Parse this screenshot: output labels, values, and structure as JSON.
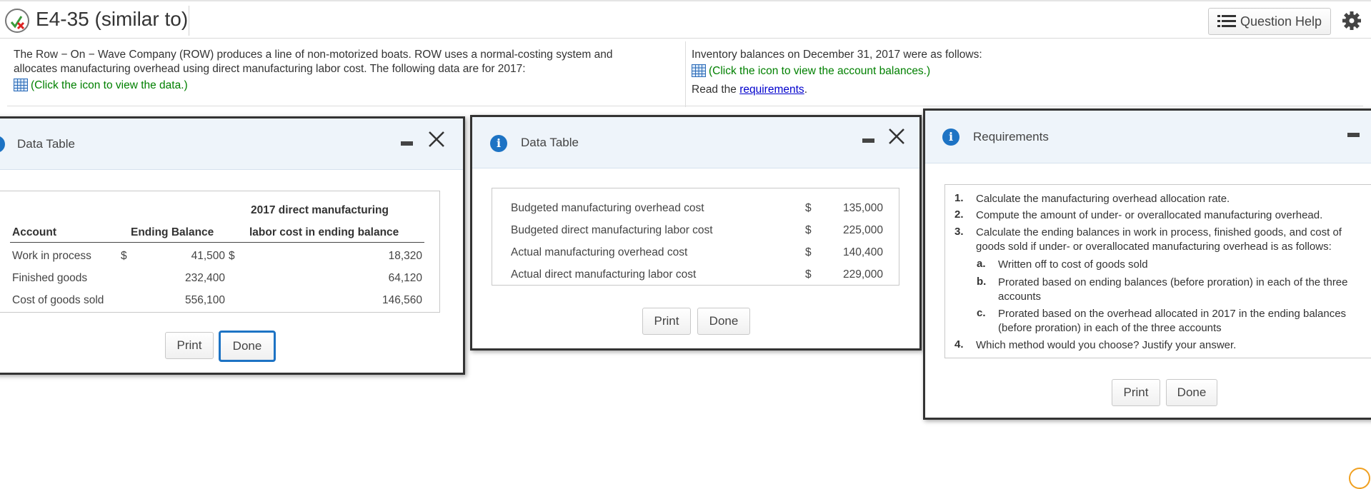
{
  "header": {
    "title": "E4-35 (similar to)",
    "question_help": "Question Help"
  },
  "problem": {
    "intro": "The Row − On − Wave Company (ROW) produces a line of non-motorized boats. ROW uses a normal-costing system and allocates manufacturing overhead using direct manufacturing labor cost. The following data are for 2017:",
    "data_link": "(Click the icon to view the data.)",
    "inventory_intro": "Inventory balances on December 31, 2017 were as follows:",
    "balances_link": "(Click the icon to view the account balances.)",
    "read_the": "Read the ",
    "requirements_link": "requirements",
    "period": "."
  },
  "dialog1": {
    "title": "Data Table",
    "header_line1": "2017 direct manufacturing",
    "col_account": "Account",
    "col_ending": "Ending Balance",
    "col_labor": "labor cost in ending balance",
    "rows": [
      {
        "account": "Work in process",
        "cur1": "$",
        "ending": "41,500",
        "cur2": "$",
        "labor": "18,320"
      },
      {
        "account": "Finished goods",
        "cur1": "",
        "ending": "232,400",
        "cur2": "",
        "labor": "64,120"
      },
      {
        "account": "Cost of goods sold",
        "cur1": "",
        "ending": "556,100",
        "cur2": "",
        "labor": "146,560"
      }
    ],
    "print": "Print",
    "done": "Done"
  },
  "dialog2": {
    "title": "Data Table",
    "rows": [
      {
        "label": "Budgeted manufacturing overhead cost",
        "cur": "$",
        "value": "135,000"
      },
      {
        "label": "Budgeted direct manufacturing labor cost",
        "cur": "$",
        "value": "225,000"
      },
      {
        "label": "Actual manufacturing overhead cost",
        "cur": "$",
        "value": "140,400"
      },
      {
        "label": "Actual direct manufacturing labor cost",
        "cur": "$",
        "value": "229,000"
      }
    ],
    "print": "Print",
    "done": "Done"
  },
  "dialog3": {
    "title": "Requirements",
    "items": [
      {
        "num": "1.",
        "text": "Calculate the manufacturing overhead allocation rate."
      },
      {
        "num": "2.",
        "text": "Compute the amount of under- or overallocated manufacturing overhead."
      },
      {
        "num": "3.",
        "text": "Calculate the ending balances in work in process, finished goods, and cost of goods sold if under- or overallocated manufacturing overhead is as follows:"
      },
      {
        "num": "4.",
        "text": "Which method would you choose? Justify your answer."
      }
    ],
    "subitems": [
      {
        "num": "a.",
        "text": "Written off to cost of goods sold"
      },
      {
        "num": "b.",
        "text": "Prorated based on ending balances (before proration) in each of the three accounts"
      },
      {
        "num": "c.",
        "text": "Prorated based on the overhead allocated in 2017 in the ending balances (before proration) in each of the three accounts"
      }
    ],
    "print": "Print",
    "done": "Done"
  }
}
